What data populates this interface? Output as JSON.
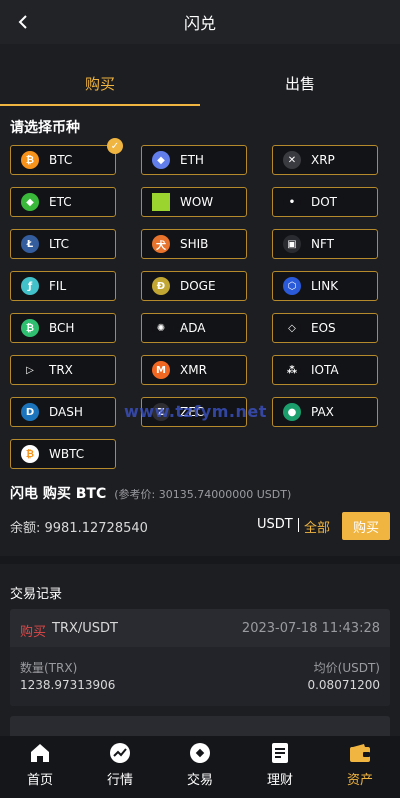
{
  "header": {
    "title": "闪兑",
    "back_icon": "chevron-left-icon"
  },
  "tabs": [
    {
      "label": "购买",
      "active": true
    },
    {
      "label": "出售",
      "active": false
    }
  ],
  "section_label": "请选择币种",
  "coins": [
    {
      "symbol": "BTC",
      "icon": "btc-icon",
      "color": "#f7931a",
      "glyph": "₿",
      "selected": true
    },
    {
      "symbol": "ETH",
      "icon": "eth-icon",
      "color": "#627eea",
      "glyph": "◆"
    },
    {
      "symbol": "XRP",
      "icon": "xrp-icon",
      "color": "#3a3b40",
      "glyph": "✕"
    },
    {
      "symbol": "ETC",
      "icon": "etc-icon",
      "color": "#3ab83a",
      "glyph": "◆"
    },
    {
      "symbol": "WOW",
      "icon": "wow-icon",
      "color": "#9bd32f",
      "glyph": ""
    },
    {
      "symbol": "DOT",
      "icon": "dot-icon",
      "color": "#121316",
      "glyph": "•"
    },
    {
      "symbol": "LTC",
      "icon": "ltc-icon",
      "color": "#345d9d",
      "glyph": "Ł"
    },
    {
      "symbol": "SHIB",
      "icon": "shib-icon",
      "color": "#e8732c",
      "glyph": "犬"
    },
    {
      "symbol": "NFT",
      "icon": "nft-icon",
      "color": "#2a2b30",
      "glyph": "▣"
    },
    {
      "symbol": "FIL",
      "icon": "fil-icon",
      "color": "#42c1ca",
      "glyph": "ƒ"
    },
    {
      "symbol": "DOGE",
      "icon": "doge-icon",
      "color": "#c2a633",
      "glyph": "Ð"
    },
    {
      "symbol": "LINK",
      "icon": "link-icon",
      "color": "#2a5ada",
      "glyph": "⬡"
    },
    {
      "symbol": "BCH",
      "icon": "bch-icon",
      "color": "#2fbf71",
      "glyph": "₿"
    },
    {
      "symbol": "ADA",
      "icon": "ada-icon",
      "color": "#121316",
      "glyph": "✺"
    },
    {
      "symbol": "EOS",
      "icon": "eos-icon",
      "color": "#121316",
      "glyph": "◇"
    },
    {
      "symbol": "TRX",
      "icon": "trx-icon",
      "color": "#121316",
      "glyph": "▷"
    },
    {
      "symbol": "XMR",
      "icon": "xmr-icon",
      "color": "#f26822",
      "glyph": "M"
    },
    {
      "symbol": "IOTA",
      "icon": "iota-icon",
      "color": "#121316",
      "glyph": "⁂"
    },
    {
      "symbol": "DASH",
      "icon": "dash-icon",
      "color": "#1c75bc",
      "glyph": "D"
    },
    {
      "symbol": "ZEC",
      "icon": "zec-icon",
      "color": "#2e2e33",
      "glyph": "Z"
    },
    {
      "symbol": "PAX",
      "icon": "pax-icon",
      "color": "#1b9e6c",
      "glyph": "●"
    },
    {
      "symbol": "WBTC",
      "icon": "wbtc-icon",
      "color": "#ffffff",
      "glyph": "₿"
    }
  ],
  "selected_check": "✓",
  "flash": {
    "title": "闪电 购买 BTC",
    "ref_price": "(参考价: 30135.74000000 USDT)"
  },
  "balance": {
    "label_value": "余额: 9981.12728540",
    "unit": "USDT",
    "all_label": "全部",
    "buy_label": "购买"
  },
  "records_title": "交易记录",
  "record": {
    "side": "购买",
    "pair": "TRX/USDT",
    "time": "2023-07-18 11:43:28",
    "qty_label": "数量(TRX)",
    "qty_value": "1238.97313906",
    "price_label": "均价(USDT)",
    "price_value": "0.08071200"
  },
  "watermark": "www.tzfym.net",
  "nav": [
    {
      "label": "首页",
      "icon": "home-icon",
      "active": false
    },
    {
      "label": "行情",
      "icon": "chart-icon",
      "active": false
    },
    {
      "label": "交易",
      "icon": "trade-icon",
      "active": false
    },
    {
      "label": "理财",
      "icon": "finance-icon",
      "active": false
    },
    {
      "label": "资产",
      "icon": "wallet-icon",
      "active": true
    }
  ],
  "colors": {
    "accent": "#f0b440",
    "sell_red": "#e04848",
    "background": "#1d1e22"
  }
}
